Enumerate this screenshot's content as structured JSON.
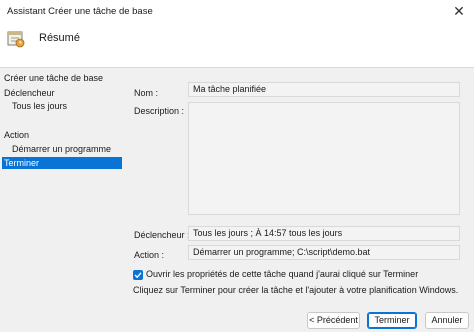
{
  "window": {
    "title": "Assistant Créer une tâche de base",
    "close_glyph": "✕"
  },
  "header": {
    "title": "Résumé",
    "icon": "task-calendar-icon"
  },
  "sidebar": {
    "items": [
      {
        "label": "Créer une tâche de base",
        "active": false
      },
      {
        "label": "Déclencheur",
        "active": false
      },
      {
        "label": "Tous les jours",
        "active": false
      },
      {
        "label": "Action",
        "active": false
      },
      {
        "label": "Démarrer un programme",
        "active": false
      },
      {
        "label": "Terminer",
        "active": true
      }
    ]
  },
  "summary": {
    "name_label": "Nom :",
    "name_value": "Ma tâche planifiée",
    "description_label": "Description :",
    "description_value": "",
    "trigger_label": "Déclencheur :",
    "trigger_value": "Tous les jours ; À 14:57 tous les jours",
    "action_label": "Action :",
    "action_value": "Démarrer un programme; C:\\script\\demo.bat"
  },
  "options": {
    "open_properties_label": "Ouvrir les propriétés de cette tâche quand j'aurai cliqué sur Terminer",
    "open_properties_checked": true,
    "info_text": "Cliquez sur Terminer pour créer la tâche et l'ajouter à votre planification Windows."
  },
  "buttons": {
    "back": "< Précédent",
    "finish": "Terminer",
    "cancel": "Annuler"
  },
  "colors": {
    "accent": "#0a74d6"
  }
}
